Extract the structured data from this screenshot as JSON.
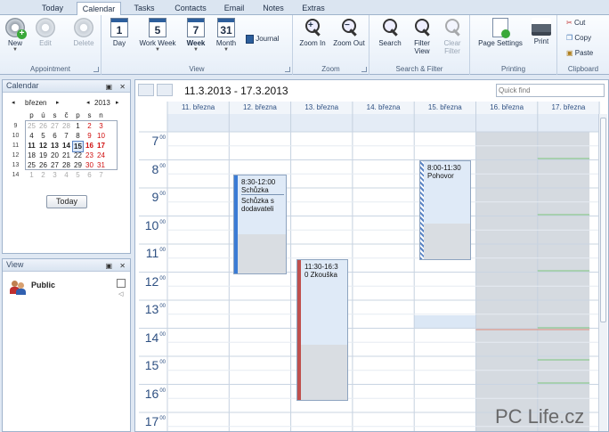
{
  "tabs": [
    "Today",
    "Calendar",
    "Tasks",
    "Contacts",
    "Email",
    "Notes",
    "Extras"
  ],
  "active_tab": "Calendar",
  "ribbon": {
    "appointment": {
      "label": "Appointment",
      "new": "New",
      "edit": "Edit",
      "delete": "Delete"
    },
    "view": {
      "label": "View",
      "day": "Day",
      "work_week": "Work Week",
      "week": "Week",
      "month": "Month",
      "journal": "Journal",
      "day_num": "1",
      "work_week_num": "5",
      "week_num": "7",
      "month_num": "31"
    },
    "zoom": {
      "label": "Zoom",
      "zoom_in": "Zoom In",
      "zoom_out": "Zoom Out"
    },
    "search_filter": {
      "label": "Search & Filter",
      "search": "Search",
      "filter_view": "Filter View",
      "clear_filter": "Clear Filter"
    },
    "printing": {
      "label": "Printing",
      "page_settings": "Page Settings",
      "print": "Print"
    },
    "clipboard": {
      "label": "Clipboard",
      "cut": "Cut",
      "copy": "Copy",
      "paste": "Paste"
    }
  },
  "calendar_panel": {
    "title": "Calendar",
    "month": "březen",
    "year": "2013",
    "day_headers": [
      "p",
      "ú",
      "s",
      "č",
      "p",
      "s",
      "n"
    ],
    "weeks": [
      {
        "wk": "9",
        "days": [
          "25",
          "26",
          "27",
          "28",
          "1",
          "2",
          "3"
        ]
      },
      {
        "wk": "10",
        "days": [
          "4",
          "5",
          "6",
          "7",
          "8",
          "9",
          "10"
        ]
      },
      {
        "wk": "11",
        "days": [
          "11",
          "12",
          "13",
          "14",
          "15",
          "16",
          "17"
        ]
      },
      {
        "wk": "12",
        "days": [
          "18",
          "19",
          "20",
          "21",
          "22",
          "23",
          "24"
        ]
      },
      {
        "wk": "13",
        "days": [
          "25",
          "26",
          "27",
          "28",
          "29",
          "30",
          "31"
        ]
      },
      {
        "wk": "14",
        "days": [
          "1",
          "2",
          "3",
          "4",
          "5",
          "6",
          "7"
        ]
      }
    ],
    "today_button": "Today"
  },
  "view_panel": {
    "title": "View",
    "item": "Public"
  },
  "main": {
    "range_title": "11.3.2013 - 17.3.2013",
    "quick_find_placeholder": "Quick find",
    "days": [
      "11. března",
      "12. března",
      "13. března",
      "14. března",
      "15. března",
      "16. března",
      "17. března"
    ],
    "hours": [
      "7",
      "8",
      "9",
      "10",
      "11",
      "12",
      "13",
      "14",
      "15",
      "16",
      "17"
    ],
    "minute_suffix": "00",
    "appointments": [
      {
        "time": "8:30-12:00",
        "title": "Schůzka",
        "body": "Schůzka s dodavateli",
        "color": "#3a7bd5"
      },
      {
        "time": "11:30-16:3",
        "title": "0 Zkouška",
        "body": "",
        "color": "#c0504d"
      },
      {
        "time": "8:00-11:30",
        "title": "Pohovor",
        "body": "",
        "color": "#5b84c4"
      }
    ]
  },
  "watermark": "PC Life.cz"
}
